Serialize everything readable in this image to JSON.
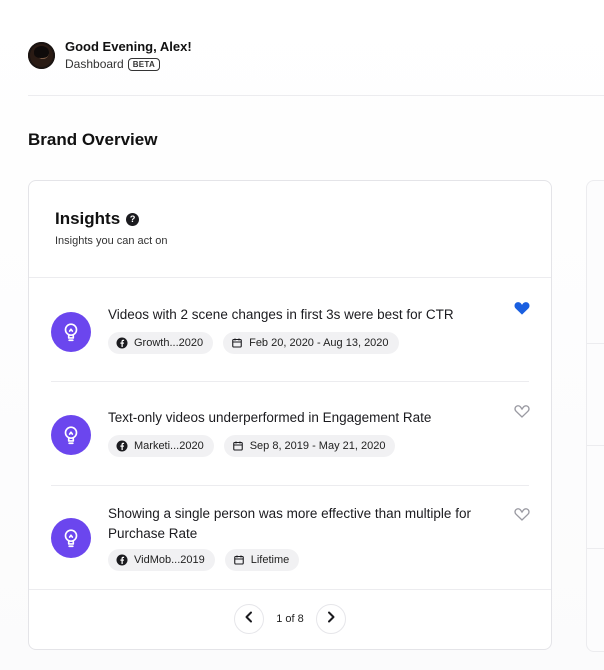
{
  "header": {
    "greeting": "Good Evening, Alex!",
    "subtitle": "Dashboard",
    "badge": "BETA"
  },
  "section": {
    "title": "Brand Overview"
  },
  "card": {
    "title": "Insights",
    "subtitle": "Insights you can act on",
    "help_icon": "help-icon",
    "insights": [
      {
        "text": "Videos with 2 scene changes in first 3s were best for CTR",
        "source": "Growth...2020",
        "date_range": "Feb 20, 2020 - Aug 13, 2020",
        "liked": true
      },
      {
        "text": "Text-only videos underperformed in Engagement Rate",
        "source": "Marketi...2020",
        "date_range": "Sep 8, 2019 - May 21, 2020",
        "liked": false
      },
      {
        "text": "Showing a single person was more effective than multiple for Purchase Rate",
        "source": "VidMob...2019",
        "date_range": "Lifetime",
        "liked": false
      }
    ],
    "pagination": {
      "label": "1 of 8"
    }
  },
  "colors": {
    "accent_purple": "#6b46ee",
    "heart_active": "#1a5fe0",
    "heart_inactive": "#9a9aa2"
  },
  "icons": {
    "insight": "lightbulb-icon",
    "source": "facebook-icon",
    "date": "calendar-icon",
    "like": "heart-icon",
    "prev": "chevron-left-icon",
    "next": "chevron-right-icon"
  }
}
